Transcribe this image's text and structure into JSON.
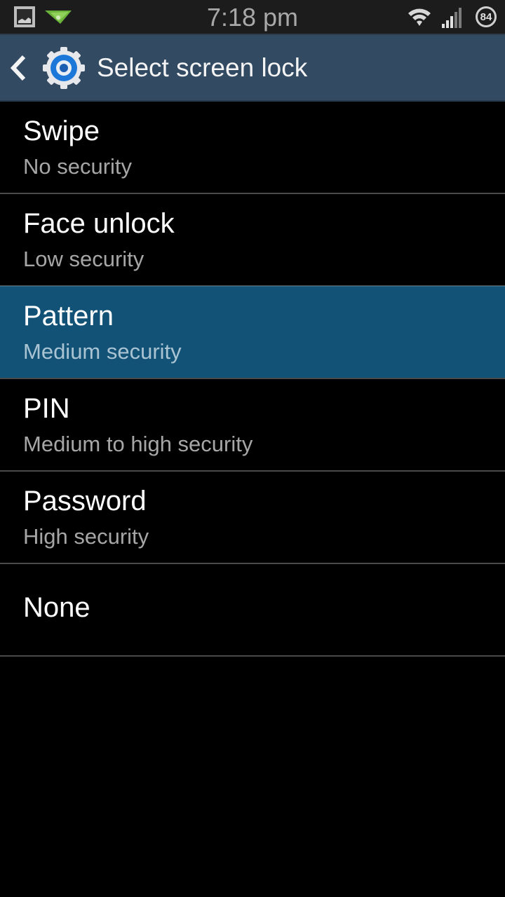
{
  "status_bar": {
    "time": "7:18 pm",
    "battery_level": "84",
    "left_icons": [
      "gallery-icon",
      "airdroid-icon"
    ],
    "right_icons": [
      "wifi-icon",
      "signal-icon",
      "battery-icon"
    ]
  },
  "action_bar": {
    "title": "Select screen lock",
    "back_icon": "back-chevron-icon",
    "app_icon": "settings-gear-icon"
  },
  "colors": {
    "action_bar_bg": "#334a63",
    "selected_item_bg": "#125276",
    "divider": "#4a4a4a"
  },
  "lock_options": [
    {
      "label": "Swipe",
      "description": "No security",
      "selected": false
    },
    {
      "label": "Face unlock",
      "description": "Low security",
      "selected": false
    },
    {
      "label": "Pattern",
      "description": "Medium security",
      "selected": true
    },
    {
      "label": "PIN",
      "description": "Medium to high security",
      "selected": false
    },
    {
      "label": "Password",
      "description": "High security",
      "selected": false
    },
    {
      "label": "None",
      "description": null,
      "selected": false
    }
  ]
}
